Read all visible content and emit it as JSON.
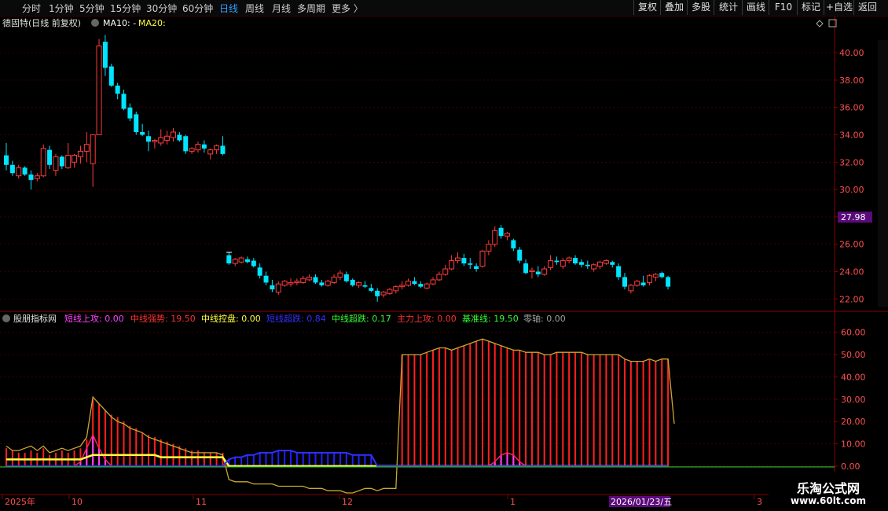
{
  "timeframes": [
    {
      "label": "分时",
      "active": false
    },
    {
      "label": "1分钟",
      "active": false
    },
    {
      "label": "5分钟",
      "active": false
    },
    {
      "label": "15分钟",
      "active": false
    },
    {
      "label": "30分钟",
      "active": false
    },
    {
      "label": "60分钟",
      "active": false
    },
    {
      "label": "日线",
      "active": true
    },
    {
      "label": "周线",
      "active": false
    },
    {
      "label": "月线",
      "active": false
    },
    {
      "label": "多周期",
      "active": false
    },
    {
      "label": "更多 〉",
      "active": false
    }
  ],
  "toolbar": [
    "复权",
    "叠加",
    "多股",
    "统计",
    "画线",
    "F10",
    "标记",
    "+自选",
    "返回"
  ],
  "main": {
    "title": "德固特(日线 前复权)",
    "ma10": "MA10: -",
    "ma20": "MA20:",
    "price_label": "27.98",
    "y_ticks": [
      "40.00",
      "38.00",
      "36.00",
      "34.00",
      "32.00",
      "30.00",
      "28.00",
      "26.00",
      "24.00",
      "22.00"
    ]
  },
  "indicator": {
    "name": "股朋指标网",
    "items": [
      {
        "label": "短线上攻: 0.00",
        "color": "#ff40ff"
      },
      {
        "label": "中线强势: 19.50",
        "color": "#ff3030"
      },
      {
        "label": "中线控盘: 0.00",
        "color": "#ffff40"
      },
      {
        "label": "短线超跌: 0.84",
        "color": "#3030ff"
      },
      {
        "label": "中线超跌: 0.17",
        "color": "#30ff30"
      },
      {
        "label": "主力上攻: 0.00",
        "color": "#ff3030"
      },
      {
        "label": "基准线: 19.50",
        "color": "#30ff30"
      },
      {
        "label": "零轴: 0.00",
        "color": "#a0a0a0"
      }
    ],
    "y_ticks": [
      "60.00",
      "50.00",
      "40.00",
      "30.00",
      "20.00",
      "10.00",
      "0.00"
    ]
  },
  "x_axis": {
    "labels": [
      "2025年",
      "10",
      "11",
      "12",
      "1",
      "3"
    ],
    "cursor_date": "2026/01/23/五"
  },
  "watermark": {
    "line1": "乐淘公式网",
    "line2": "www.60lt.com"
  },
  "colors": {
    "up": "#ff3c3c",
    "down": "#00e5ff",
    "axis": "#8a0000",
    "grid": "#5a0000",
    "tick_text": "#ff5050"
  },
  "chart_data": {
    "type": "candlestick",
    "ylim": [
      21.5,
      41.5
    ],
    "candles": [
      [
        32.5,
        33.4,
        31.4,
        31.8
      ],
      [
        31.8,
        32.1,
        31.0,
        31.2
      ],
      [
        31.0,
        31.8,
        30.8,
        31.6
      ],
      [
        31.6,
        31.7,
        31.0,
        31.1
      ],
      [
        31.1,
        31.4,
        30.0,
        30.7
      ],
      [
        30.8,
        31.2,
        30.6,
        31.0
      ],
      [
        31.0,
        33.3,
        30.9,
        33.0
      ],
      [
        32.9,
        33.2,
        31.5,
        31.8
      ],
      [
        31.4,
        32.6,
        31.0,
        32.4
      ],
      [
        32.4,
        32.5,
        31.5,
        31.7
      ],
      [
        31.6,
        33.4,
        31.5,
        32.5
      ],
      [
        32.0,
        32.6,
        31.6,
        32.5
      ],
      [
        32.4,
        33.2,
        31.9,
        32.8
      ],
      [
        32.8,
        34.2,
        32.0,
        33.3
      ],
      [
        31.9,
        34.0,
        30.2,
        34.0
      ],
      [
        34.0,
        41.0,
        34.0,
        40.5
      ],
      [
        40.8,
        41.3,
        38.3,
        38.9
      ],
      [
        39.0,
        39.2,
        37.5,
        37.6
      ],
      [
        37.6,
        37.8,
        36.6,
        37.0
      ],
      [
        37.0,
        37.3,
        35.8,
        35.9
      ],
      [
        36.0,
        36.3,
        35.0,
        35.2
      ],
      [
        35.5,
        35.7,
        34.0,
        34.2
      ],
      [
        34.2,
        34.8,
        33.9,
        34.0
      ],
      [
        33.9,
        34.3,
        32.8,
        33.5
      ],
      [
        33.5,
        33.7,
        33.0,
        33.6
      ],
      [
        33.4,
        34.4,
        33.2,
        33.8
      ],
      [
        33.6,
        34.3,
        33.3,
        33.9
      ],
      [
        33.8,
        34.5,
        33.5,
        34.2
      ],
      [
        34.0,
        34.2,
        33.5,
        33.6
      ],
      [
        33.9,
        34.0,
        32.6,
        32.8
      ],
      [
        32.8,
        33.1,
        32.6,
        33.0
      ],
      [
        32.9,
        33.5,
        32.7,
        33.3
      ],
      [
        33.3,
        33.6,
        32.7,
        33.0
      ],
      [
        32.6,
        33.0,
        32.2,
        32.9
      ],
      [
        32.9,
        33.3,
        32.6,
        33.2
      ],
      [
        33.2,
        33.9,
        32.5,
        32.6
      ],
      [
        25.2,
        25.4,
        24.5,
        24.6
      ],
      [
        24.6,
        25.0,
        24.4,
        24.9
      ],
      [
        24.7,
        25.1,
        24.6,
        25.0
      ],
      [
        24.9,
        25.1,
        24.6,
        24.7
      ],
      [
        24.8,
        25.0,
        24.3,
        24.4
      ],
      [
        24.3,
        24.6,
        23.5,
        23.7
      ],
      [
        23.7,
        24.0,
        23.0,
        23.2
      ],
      [
        23.0,
        23.4,
        22.5,
        22.7
      ],
      [
        22.5,
        23.3,
        22.3,
        23.1
      ],
      [
        23.0,
        23.4,
        22.9,
        23.3
      ],
      [
        23.1,
        23.5,
        22.9,
        23.2
      ],
      [
        23.2,
        23.5,
        23.0,
        23.3
      ],
      [
        23.2,
        23.7,
        23.1,
        23.5
      ],
      [
        23.4,
        23.8,
        23.3,
        23.6
      ],
      [
        23.6,
        23.8,
        23.1,
        23.2
      ],
      [
        23.2,
        23.4,
        22.9,
        23.0
      ],
      [
        23.0,
        23.4,
        22.9,
        23.3
      ],
      [
        23.2,
        23.8,
        23.1,
        23.6
      ],
      [
        23.6,
        24.1,
        23.4,
        23.9
      ],
      [
        23.8,
        24.0,
        23.2,
        23.3
      ],
      [
        23.4,
        23.5,
        22.9,
        23.0
      ],
      [
        23.0,
        23.3,
        22.8,
        23.2
      ],
      [
        23.0,
        23.3,
        22.8,
        22.9
      ],
      [
        22.8,
        23.1,
        22.5,
        22.6
      ],
      [
        22.6,
        22.8,
        21.8,
        22.2
      ],
      [
        22.3,
        22.6,
        22.1,
        22.5
      ],
      [
        22.4,
        22.8,
        22.3,
        22.7
      ],
      [
        22.6,
        23.0,
        22.4,
        22.9
      ],
      [
        22.9,
        23.3,
        22.7,
        23.0
      ],
      [
        23.0,
        23.5,
        22.9,
        23.3
      ],
      [
        23.3,
        23.6,
        23.0,
        23.1
      ],
      [
        23.1,
        23.3,
        22.8,
        22.9
      ],
      [
        22.8,
        23.2,
        22.7,
        23.1
      ],
      [
        23.1,
        23.6,
        23.0,
        23.4
      ],
      [
        23.4,
        24.0,
        23.3,
        23.8
      ],
      [
        23.8,
        24.5,
        23.7,
        24.2
      ],
      [
        24.2,
        25.2,
        24.1,
        24.8
      ],
      [
        24.8,
        25.4,
        24.6,
        25.0
      ],
      [
        25.0,
        25.3,
        24.4,
        24.6
      ],
      [
        24.6,
        25.0,
        24.2,
        24.5
      ],
      [
        24.4,
        24.6,
        24.0,
        24.2
      ],
      [
        24.4,
        25.6,
        24.3,
        25.5
      ],
      [
        25.5,
        26.3,
        25.2,
        26.0
      ],
      [
        26.0,
        27.3,
        25.8,
        27.0
      ],
      [
        27.2,
        27.4,
        26.4,
        26.6
      ],
      [
        26.6,
        26.9,
        26.3,
        26.8
      ],
      [
        26.3,
        26.4,
        25.5,
        25.7
      ],
      [
        25.6,
        25.8,
        24.6,
        24.8
      ],
      [
        24.6,
        24.9,
        23.8,
        23.9
      ],
      [
        24.0,
        24.3,
        23.5,
        24.1
      ],
      [
        24.0,
        24.4,
        23.6,
        23.8
      ],
      [
        23.8,
        24.4,
        23.7,
        24.2
      ],
      [
        24.3,
        25.2,
        24.1,
        24.8
      ],
      [
        24.8,
        25.1,
        24.5,
        24.7
      ],
      [
        24.4,
        25.0,
        24.2,
        24.8
      ],
      [
        24.8,
        25.1,
        24.6,
        25.0
      ],
      [
        25.0,
        25.2,
        24.5,
        24.6
      ],
      [
        24.7,
        24.9,
        24.3,
        24.5
      ],
      [
        24.5,
        24.8,
        24.2,
        24.4
      ],
      [
        24.2,
        24.6,
        24.0,
        24.5
      ],
      [
        24.4,
        24.8,
        24.2,
        24.7
      ],
      [
        24.6,
        24.9,
        24.5,
        24.8
      ],
      [
        24.7,
        24.8,
        24.3,
        24.5
      ],
      [
        24.4,
        24.6,
        23.4,
        23.6
      ],
      [
        23.6,
        23.9,
        22.7,
        22.9
      ],
      [
        22.6,
        23.1,
        22.4,
        23.0
      ],
      [
        23.0,
        23.4,
        22.9,
        23.3
      ],
      [
        23.2,
        23.7,
        22.9,
        23.0
      ],
      [
        23.2,
        23.8,
        23.0,
        23.7
      ],
      [
        23.6,
        23.9,
        23.3,
        23.8
      ],
      [
        23.9,
        24.0,
        23.5,
        23.6
      ],
      [
        23.6,
        23.7,
        22.7,
        22.9
      ]
    ],
    "indicator_ylim": [
      -12,
      62
    ],
    "zhongxian_qiangshi": [
      8,
      7,
      6,
      6,
      7,
      6,
      8,
      5,
      6,
      7,
      6,
      7,
      8,
      12,
      30,
      28,
      25,
      23,
      22,
      20,
      18,
      17,
      15,
      14,
      13,
      12,
      11,
      10,
      9,
      8,
      7,
      7,
      6,
      6,
      6,
      6,
      0,
      0,
      0,
      0,
      0,
      0,
      0,
      0,
      0,
      0,
      0,
      0,
      0,
      0,
      0,
      0,
      0,
      0,
      0,
      0,
      0,
      0,
      0,
      0,
      0,
      0,
      0,
      0,
      0,
      0,
      0,
      0,
      0,
      0,
      0,
      0,
      0,
      0,
      0,
      0,
      0,
      0,
      0,
      0,
      0,
      0,
      0,
      0,
      0,
      0,
      0,
      0,
      0,
      0,
      0,
      0,
      0,
      0,
      0,
      0,
      0,
      0,
      0,
      0,
      0,
      0,
      0,
      0,
      0,
      0,
      0,
      0
    ],
    "jizhunxian": [
      9,
      7,
      7,
      8,
      9,
      7,
      9,
      6,
      7,
      8,
      7,
      8,
      9,
      13,
      31,
      28,
      25,
      22,
      20,
      19,
      17,
      16,
      15,
      13,
      12,
      11,
      10,
      9,
      8,
      7,
      6,
      6,
      6,
      6,
      6,
      5,
      -6,
      -7,
      -7,
      -7,
      -8,
      -8,
      -8,
      -8,
      -9,
      -9,
      -9,
      -9,
      -9,
      -10,
      -10,
      -10,
      -11,
      -11,
      -11,
      -12,
      -12,
      -11,
      -10,
      -10,
      -11,
      -10,
      -10,
      -10,
      50,
      50,
      50,
      50,
      51,
      52,
      53,
      53,
      52,
      53,
      54,
      55,
      56,
      57,
      56,
      55,
      54,
      53,
      52,
      52,
      51,
      51,
      51,
      50,
      50,
      51,
      51,
      51,
      51,
      51,
      50,
      50,
      50,
      50,
      50,
      50,
      48,
      47,
      47,
      47,
      48,
      47,
      48,
      48,
      19
    ],
    "duanxian_shanggong": [
      0,
      0,
      0,
      0,
      0,
      0,
      0,
      0,
      0,
      0,
      0,
      0,
      2,
      8,
      14,
      8,
      3,
      0,
      0,
      0,
      0,
      0,
      0,
      0,
      0,
      0,
      0,
      0,
      0,
      0,
      0,
      0,
      0,
      0,
      0,
      0,
      0,
      0,
      0,
      0,
      0,
      0,
      0,
      0,
      0,
      0,
      0,
      0,
      0,
      0,
      0,
      0,
      0,
      0,
      0,
      0,
      0,
      0,
      0,
      0,
      0,
      0,
      0,
      0,
      0,
      0,
      0,
      0,
      0,
      0,
      0,
      0,
      0,
      0,
      0,
      0,
      0,
      0,
      0,
      2,
      5,
      6,
      5,
      2,
      0,
      0,
      0,
      0,
      0,
      0,
      0,
      0,
      0,
      0,
      0,
      0,
      0,
      0,
      0,
      0,
      0,
      0,
      0,
      0,
      0,
      0,
      0,
      0
    ],
    "zhongxian_kongpan": [
      3,
      3,
      3,
      3,
      3,
      3,
      3,
      3,
      3,
      3,
      3,
      3,
      3,
      4,
      5,
      5,
      5,
      5,
      5,
      5,
      5,
      5,
      5,
      5,
      5,
      4,
      4,
      4,
      4,
      4,
      4,
      4,
      4,
      4,
      4,
      4,
      0,
      0,
      0,
      0,
      0,
      0,
      0,
      0,
      0,
      0,
      0,
      0,
      0,
      0,
      0,
      0,
      0,
      0,
      0,
      0,
      0,
      0,
      0,
      0,
      0,
      0,
      0,
      0,
      0,
      0,
      0,
      0,
      0,
      0,
      0,
      0,
      0,
      0,
      0,
      0,
      0,
      0,
      0,
      0,
      0,
      0,
      0,
      0,
      0,
      0,
      0,
      0,
      0,
      0,
      0,
      0,
      0,
      0,
      0,
      0,
      0,
      0,
      0,
      0,
      0,
      0,
      0,
      0,
      0,
      0,
      0,
      0
    ],
    "duanxian_chaodie": [
      0,
      0,
      0,
      0,
      0,
      0,
      0,
      0,
      0,
      0,
      0,
      0,
      0,
      0,
      0,
      0,
      0,
      0,
      0,
      0,
      0,
      0,
      0,
      0,
      0,
      0,
      0,
      0,
      0,
      0,
      0,
      0,
      0,
      0,
      0,
      0,
      3,
      4,
      4,
      5,
      5,
      6,
      6,
      6,
      7,
      7,
      7,
      6,
      6,
      6,
      6,
      6,
      6,
      6,
      6,
      6,
      5,
      5,
      5,
      5,
      0,
      0,
      0,
      0,
      0,
      0,
      0,
      0,
      0,
      0,
      0,
      0,
      0,
      0,
      0,
      0,
      0,
      0,
      0,
      0,
      0,
      0,
      0,
      0,
      0,
      0,
      0,
      0,
      0,
      0,
      0,
      0,
      0,
      0,
      0,
      0,
      0,
      0,
      0,
      0,
      0,
      0,
      0,
      0,
      0,
      0,
      0,
      0
    ]
  }
}
